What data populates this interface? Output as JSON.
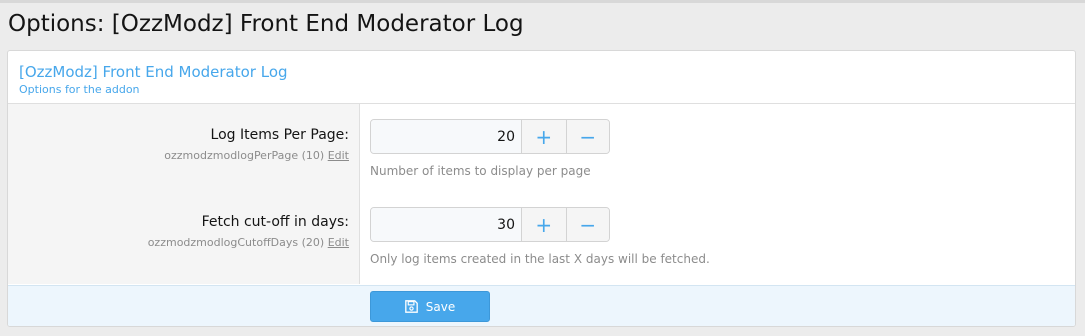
{
  "page": {
    "title": "Options: [OzzModz] Front End Moderator Log"
  },
  "block": {
    "title": "[OzzModz] Front End Moderator Log",
    "description": "Options for the addon"
  },
  "options": [
    {
      "label": "Log Items Per Page:",
      "hint": "ozzmodzmodlogPerPage (10)",
      "edit_label": "Edit",
      "value": "20",
      "explain": "Number of items to display per page"
    },
    {
      "label": "Fetch cut-off in days:",
      "hint": "ozzmodzmodlogCutoffDays (20)",
      "edit_label": "Edit",
      "value": "30",
      "explain": "Only log items created in the last X days will be fetched."
    }
  ],
  "icons": {
    "increment": "plus-icon",
    "decrement": "minus-icon",
    "save": "floppy-disk-icon"
  },
  "controls": {
    "plus": "+",
    "minus": "−"
  },
  "submit": {
    "save_label": "Save"
  },
  "colors": {
    "accent": "#47a7eb",
    "submit_bar": "#edf6fd"
  }
}
